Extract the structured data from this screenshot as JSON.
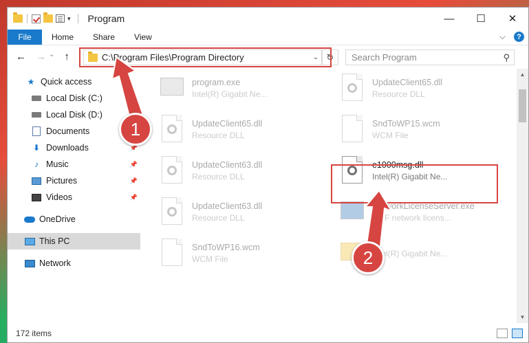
{
  "titlebar": {
    "title": "Program",
    "minimize_glyph": "—",
    "maximize_glyph": "☐",
    "close_glyph": "✕"
  },
  "ribbon": {
    "tabs": [
      "File",
      "Home",
      "Share",
      "View"
    ],
    "expand_glyph": "⌵",
    "help_glyph": "?"
  },
  "address": {
    "path": "C:\\Program Files\\Program Directory",
    "back_glyph": "←",
    "forward_glyph": "→",
    "recent_glyph": "⌄",
    "up_glyph": "↑",
    "dropdown_glyph": "⌄",
    "refresh_glyph": "↻"
  },
  "search": {
    "placeholder": "Search Program",
    "icon_glyph": "⚲"
  },
  "navpane": {
    "items": [
      {
        "label": "Quick access",
        "icon": "star-icon"
      },
      {
        "label": "Local Disk (C:)",
        "icon": "disk-icon",
        "pinned": true
      },
      {
        "label": "Local Disk (D:)",
        "icon": "disk-icon",
        "pinned": true
      },
      {
        "label": "Documents",
        "icon": "documents-icon",
        "pinned": true
      },
      {
        "label": "Downloads",
        "icon": "downloads-icon",
        "pinned": true
      },
      {
        "label": "Music",
        "icon": "music-icon",
        "pinned": true
      },
      {
        "label": "Pictures",
        "icon": "pictures-icon",
        "pinned": true
      },
      {
        "label": "Videos",
        "icon": "videos-icon",
        "pinned": true
      },
      {
        "label": "OneDrive",
        "icon": "onedrive-icon"
      },
      {
        "label": "This PC",
        "icon": "pc-icon",
        "selected": true
      },
      {
        "label": "Network",
        "icon": "network-icon"
      }
    ]
  },
  "files": [
    {
      "name": "program.exe",
      "desc": "Intel(R) Gigabit Ne...",
      "icon": "exe-icon"
    },
    {
      "name": "UpdateClient65.dll",
      "desc": "Resource DLL",
      "icon": "dll-icon"
    },
    {
      "name": "UpdateClient65.dll",
      "desc": "Resource DLL",
      "icon": "dll-icon"
    },
    {
      "name": "SndToWP15.wcm",
      "desc": "WCM File",
      "icon": "file-icon"
    },
    {
      "name": "UpdateClient63.dll",
      "desc": "Resource DLL",
      "icon": "dll-icon"
    },
    {
      "name": "e1000msg.dll",
      "desc": "Intel(R) Gigabit Ne...",
      "icon": "dll-icon",
      "highlighted": true
    },
    {
      "name": "UpdateClient63.dll",
      "desc": "Resource DLL",
      "icon": "dll-icon"
    },
    {
      "name": "NetworkLicenseServer.exe",
      "desc": "MSF network licens...",
      "icon": "exe-icon"
    },
    {
      "name": "SndToWP16.wcm",
      "desc": "WCM File",
      "icon": "file-icon"
    },
    {
      "name": "Intel(R) Gigabit Ne...",
      "desc": "",
      "icon": "folder-icon"
    }
  ],
  "statusbar": {
    "item_count": "172 items"
  },
  "callouts": {
    "one": "1",
    "two": "2"
  },
  "colors": {
    "accent": "#1979ca",
    "highlight": "#d64541"
  }
}
